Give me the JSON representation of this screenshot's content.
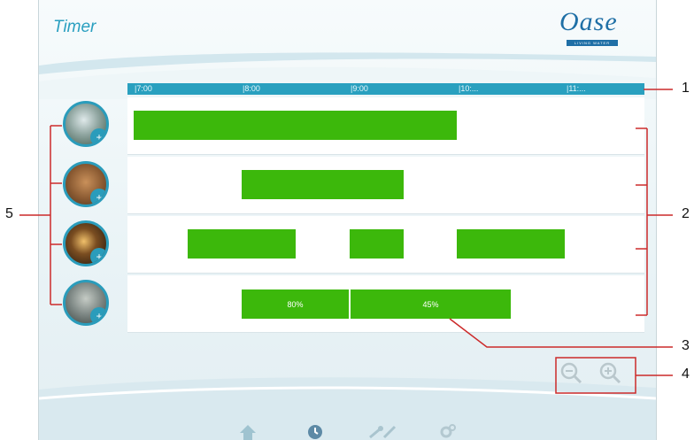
{
  "header": {
    "title": "Timer"
  },
  "logo": {
    "name": "Oase",
    "tagline": "LIVING WATER"
  },
  "timeline": {
    "ticks": [
      "|7:00",
      "|8:00",
      "|9:00",
      "|10:...",
      "|11:..."
    ]
  },
  "devices": [
    {
      "name": "fountain-device",
      "icon": "fountain-photo"
    },
    {
      "name": "waterfall-device",
      "icon": "stone-waterfall-photo"
    },
    {
      "name": "light-device",
      "icon": "pond-light-photo"
    },
    {
      "name": "rock-device",
      "icon": "rock-photo"
    }
  ],
  "rows": [
    {
      "bars": [
        {
          "label": ""
        }
      ]
    },
    {
      "bars": [
        {
          "label": ""
        }
      ]
    },
    {
      "bars": [
        {
          "label": ""
        },
        {
          "label": ""
        },
        {
          "label": ""
        }
      ]
    },
    {
      "bars": [
        {
          "label": "80%"
        },
        {
          "label": "45%"
        }
      ]
    }
  ],
  "callouts": [
    "1",
    "2",
    "3",
    "4",
    "5"
  ],
  "nav": [
    "home-icon",
    "clock-icon",
    "tools-icon",
    "settings-icon"
  ],
  "colors": {
    "accent": "#29a0bf",
    "bar": "#3cb80b",
    "callout": "#cc2a2a"
  }
}
